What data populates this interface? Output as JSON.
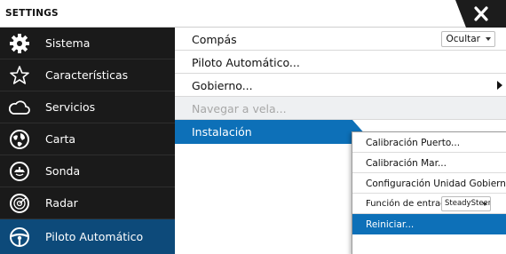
{
  "window": {
    "title": "SETTINGS",
    "close_icon": "close-icon"
  },
  "sidebar": {
    "items": [
      {
        "label": "Sistema",
        "icon": "gear-icon"
      },
      {
        "label": "Características",
        "icon": "star-icon"
      },
      {
        "label": "Servicios",
        "icon": "cloud-icon"
      },
      {
        "label": "Carta",
        "icon": "chart-icon"
      },
      {
        "label": "Sonda",
        "icon": "sonar-icon"
      },
      {
        "label": "Radar",
        "icon": "radar-icon"
      },
      {
        "label": "Piloto Automático",
        "icon": "steering-wheel-icon",
        "selected": true
      }
    ]
  },
  "main": {
    "rows": [
      {
        "label": "Compás",
        "dropdown": "Ocultar"
      },
      {
        "label": "Piloto Automático..."
      },
      {
        "label": "Gobierno...",
        "has_submenu": true
      },
      {
        "label": "Navegar a vela...",
        "disabled": true
      },
      {
        "label": "Instalación",
        "active": true
      }
    ]
  },
  "submenu": {
    "items": [
      {
        "label": "Calibración Puerto..."
      },
      {
        "label": "Calibración Mar..."
      },
      {
        "label": "Configuración Unidad Gobierno..."
      },
      {
        "label": "Función de entrada",
        "dropdown": "SteadySteer"
      },
      {
        "label": "Reiniciar...",
        "selected": true
      }
    ]
  },
  "colors": {
    "sidebar_bg": "#1a1a1a",
    "sidebar_selected": "#0d4a7a",
    "accent": "#0d70b8",
    "disabled_bg": "#eef0f2"
  }
}
